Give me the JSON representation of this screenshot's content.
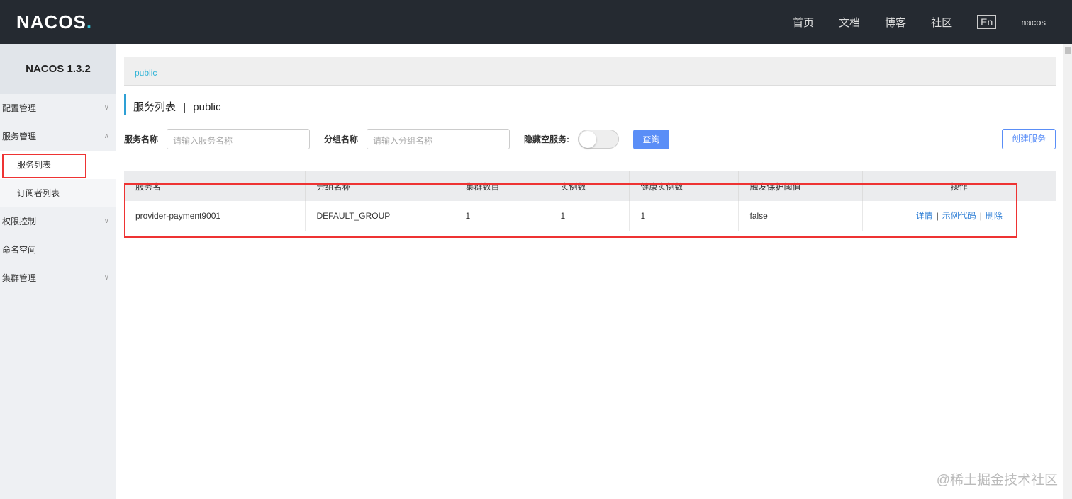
{
  "header": {
    "logo": "NACOS",
    "nav": [
      "首页",
      "文档",
      "博客",
      "社区"
    ],
    "lang": "En",
    "user": "nacos"
  },
  "sidebar": {
    "version": "NACOS 1.3.2",
    "items": [
      {
        "label": "配置管理",
        "chev": "∨"
      },
      {
        "label": "服务管理",
        "chev": "∧"
      },
      {
        "label": "服务列表"
      },
      {
        "label": "订阅者列表"
      },
      {
        "label": "权限控制",
        "chev": "∨"
      },
      {
        "label": "命名空间"
      },
      {
        "label": "集群管理",
        "chev": "∨"
      }
    ]
  },
  "breadcrumb": "public",
  "page": {
    "title": "服务列表",
    "sep": "|",
    "namespace": "public"
  },
  "filters": {
    "service_label": "服务名称",
    "service_placeholder": "请输入服务名称",
    "group_label": "分组名称",
    "group_placeholder": "请输入分组名称",
    "hide_empty_label": "隐藏空服务:",
    "query": "查询",
    "create": "创建服务"
  },
  "table": {
    "headers": [
      "服务名",
      "分组名称",
      "集群数目",
      "实例数",
      "健康实例数",
      "触发保护阈值",
      "操作"
    ],
    "rows": [
      {
        "name": "provider-payment9001",
        "group": "DEFAULT_GROUP",
        "clusters": "1",
        "instances": "1",
        "healthy": "1",
        "threshold": "false",
        "actions": [
          "详情",
          "示例代码",
          "删除"
        ]
      }
    ]
  },
  "watermark": "@稀土掘金技术社区"
}
